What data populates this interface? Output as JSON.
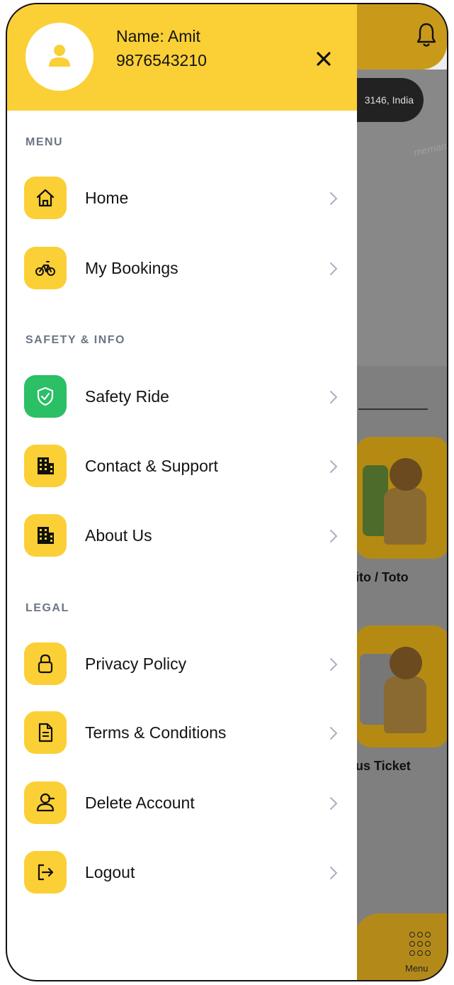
{
  "user": {
    "name": "Name: Amit",
    "phone": "9876543210"
  },
  "sections": {
    "menu": "MENU",
    "safety": "SAFETY & INFO",
    "legal": "LEGAL"
  },
  "items": [
    {
      "label": "Home",
      "icon": "home-icon"
    },
    {
      "label": "My Bookings",
      "icon": "bicycle-icon"
    },
    {
      "label": "Safety Ride",
      "icon": "shield-check-icon"
    },
    {
      "label": "Contact & Support",
      "icon": "building-icon"
    },
    {
      "label": "About Us",
      "icon": "building-icon"
    },
    {
      "label": "Privacy Policy",
      "icon": "lock-icon"
    },
    {
      "label": "Terms & Conditions",
      "icon": "document-icon"
    },
    {
      "label": "Delete Account",
      "icon": "user-remove-icon"
    },
    {
      "label": "Logout",
      "icon": "logout-icon"
    }
  ],
  "background": {
    "location": "3146, India",
    "map_label": "memari",
    "card_auto": "ito / Toto",
    "card_bus": "us Ticket",
    "menu_label": "Menu"
  },
  "colors": {
    "accent": "#fbcf36",
    "safety": "#2bbf66",
    "text": "#141414",
    "section": "#6c7585"
  }
}
